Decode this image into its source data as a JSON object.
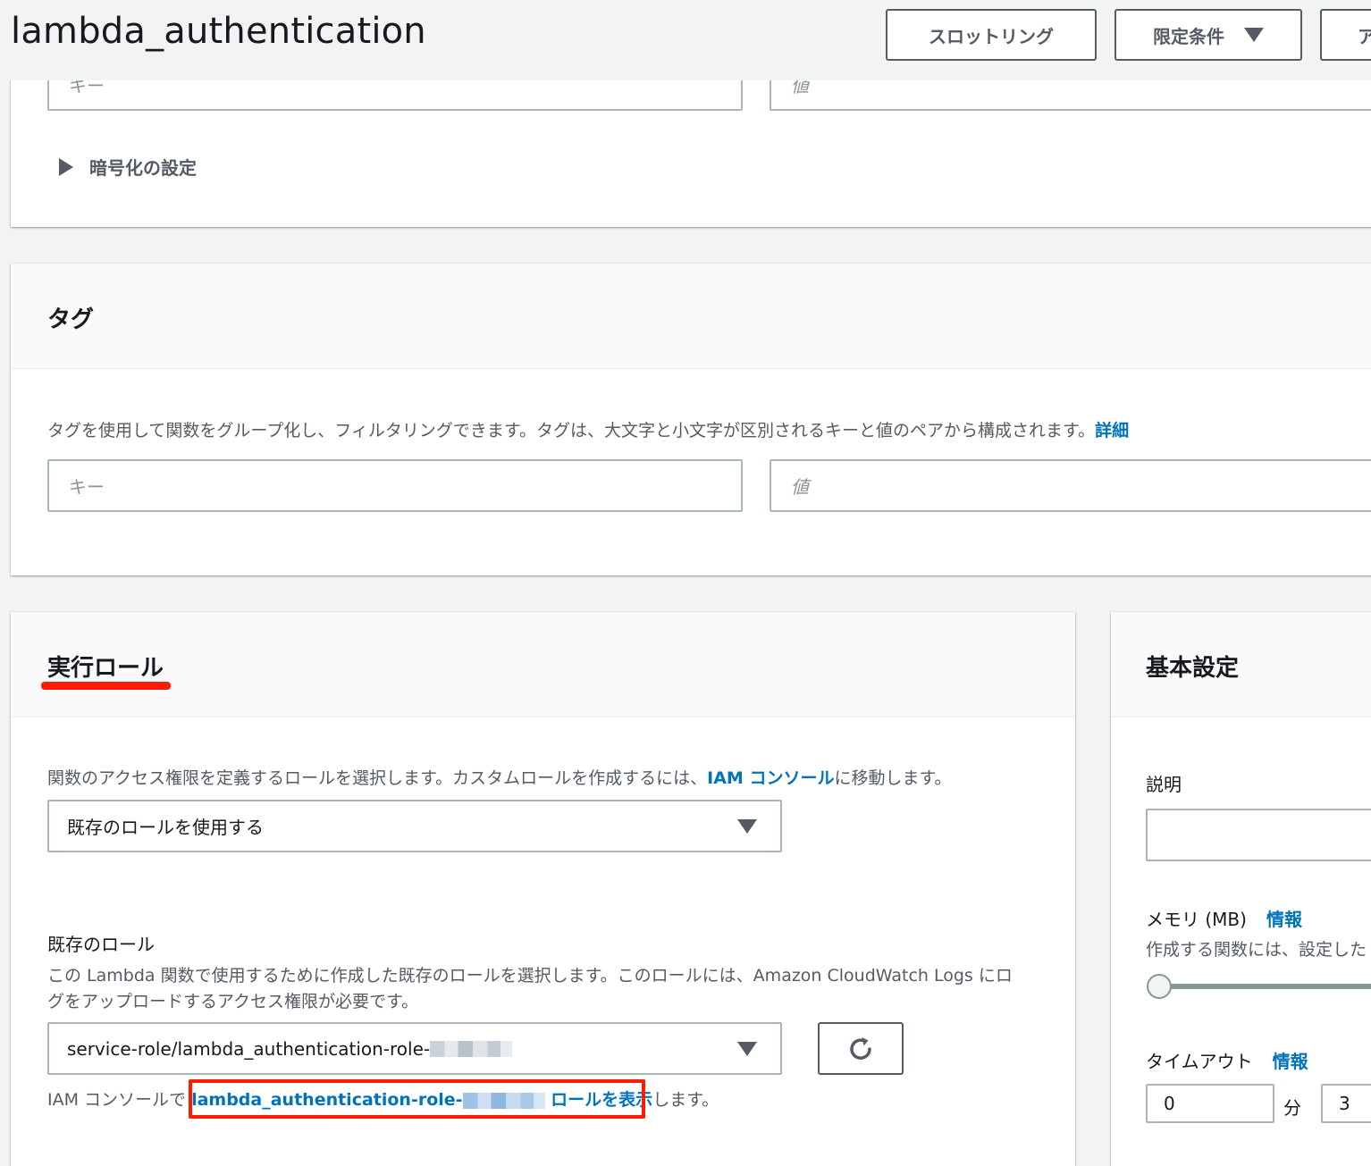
{
  "header": {
    "title": "lambda_authentication",
    "throttle_button": "スロットリング",
    "qualifiers_button": "限定条件",
    "actions_button_partial": "ア"
  },
  "env_card": {
    "key_placeholder": "キー",
    "value_placeholder": "値",
    "encryption_toggle": "暗号化の設定"
  },
  "tags_card": {
    "title": "タグ",
    "description": "タグを使用して関数をグループ化し、フィルタリングできます。タグは、大文字と小文字が区別されるキーと値のペアから構成されます。",
    "details_link": "詳細",
    "key_placeholder": "キー",
    "value_placeholder": "値"
  },
  "role_card": {
    "title": "実行ロール",
    "description_pre": "関数のアクセス権限を定義するロールを選択します。カスタムロールを作成するには、",
    "iam_console_link": "IAM コンソール",
    "description_post": "に移動します。",
    "role_mode_select": "既存のロールを使用する",
    "existing_role_label": "既存のロール",
    "existing_role_desc_line1": "この Lambda 関数で使用するために作成した既存のロールを選択します。このロールには、Amazon CloudWatch Logs にロ",
    "existing_role_desc_line2": "グをアップロードするアクセス権限が必要です。",
    "existing_role_value": "service-role/lambda_authentication-role-",
    "view_prefix": "IAM コンソールで ",
    "view_role_link": "lambda_authentication-role-",
    "view_role_link_suffix": " ロールを表示",
    "view_suffix": "します。"
  },
  "basic_card": {
    "title": "基本設定",
    "description_label": "説明",
    "memory_label": "メモリ (MB)",
    "memory_info": "情報",
    "memory_desc": "作成する関数には、設定した",
    "timeout_label": "タイムアウト",
    "timeout_info": "情報",
    "timeout_minutes": "0",
    "minutes_unit": "分",
    "timeout_seconds": "3"
  },
  "colors": {
    "accent_link": "#0073bb",
    "annotation_red": "#ff1a00"
  }
}
